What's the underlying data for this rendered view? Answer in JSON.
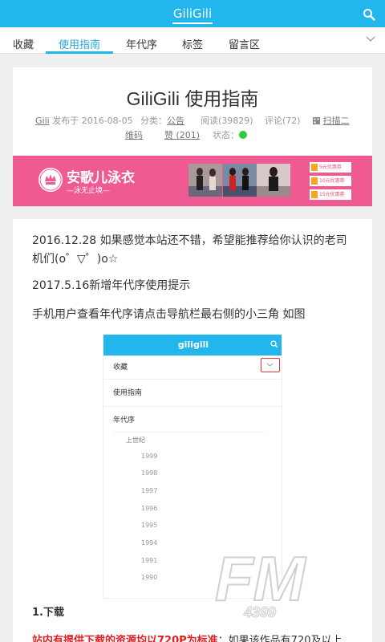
{
  "header": {
    "app_title": "GiliGili",
    "search_icon": "search-icon"
  },
  "nav": {
    "tabs": [
      {
        "label": "收藏"
      },
      {
        "label": "使用指南",
        "active": true
      },
      {
        "label": "年代序"
      },
      {
        "label": "标签"
      },
      {
        "label": "留言区"
      }
    ],
    "expand_icon": "chevron-down-icon"
  },
  "post": {
    "title": "GiliGili 使用指南",
    "author": "Gili",
    "published": "发布于 2016-08-05",
    "category_label": "分类：",
    "category": "公告",
    "reads": "阅读(39829)",
    "comments": "评论(72)",
    "qr_icon": "qr-code-icon",
    "qr_label_1": "扫描二",
    "qr_label_2": "维码",
    "likes": "赞 (201)",
    "status_label": "状态：",
    "status_color": "#2ecc40"
  },
  "ad": {
    "brand": "安歌儿泳衣",
    "tagline": "—泳无止境—",
    "coupons": [
      "5元优惠券",
      "10元优惠券",
      "15元优惠券"
    ],
    "background": "#ef5a93"
  },
  "content": {
    "p1": "2016.12.28  如果感觉本站还不错，希望能推荐给你认识的老司机们(o゜▽゜)o☆",
    "p2": "2017.5.16新增年代序使用提示",
    "p3": "手机用户查看年代序请点击导航栏最右侧的小三角  如图",
    "screenshot": {
      "brand": "giligili",
      "rows": [
        "收藏",
        "使用指南",
        "年代序"
      ],
      "sub": "上世纪",
      "years": [
        "1999",
        "1998",
        "1997",
        "1996",
        "1995",
        "1994",
        "1991",
        "1990"
      ]
    },
    "section_heading": "1.下载",
    "highlight": "站内有提供下载的资源均以720P为标准",
    "highlight_rest": "：如果该作品有720及以上"
  },
  "watermark": {
    "main": "FM",
    "sub": "4399"
  }
}
